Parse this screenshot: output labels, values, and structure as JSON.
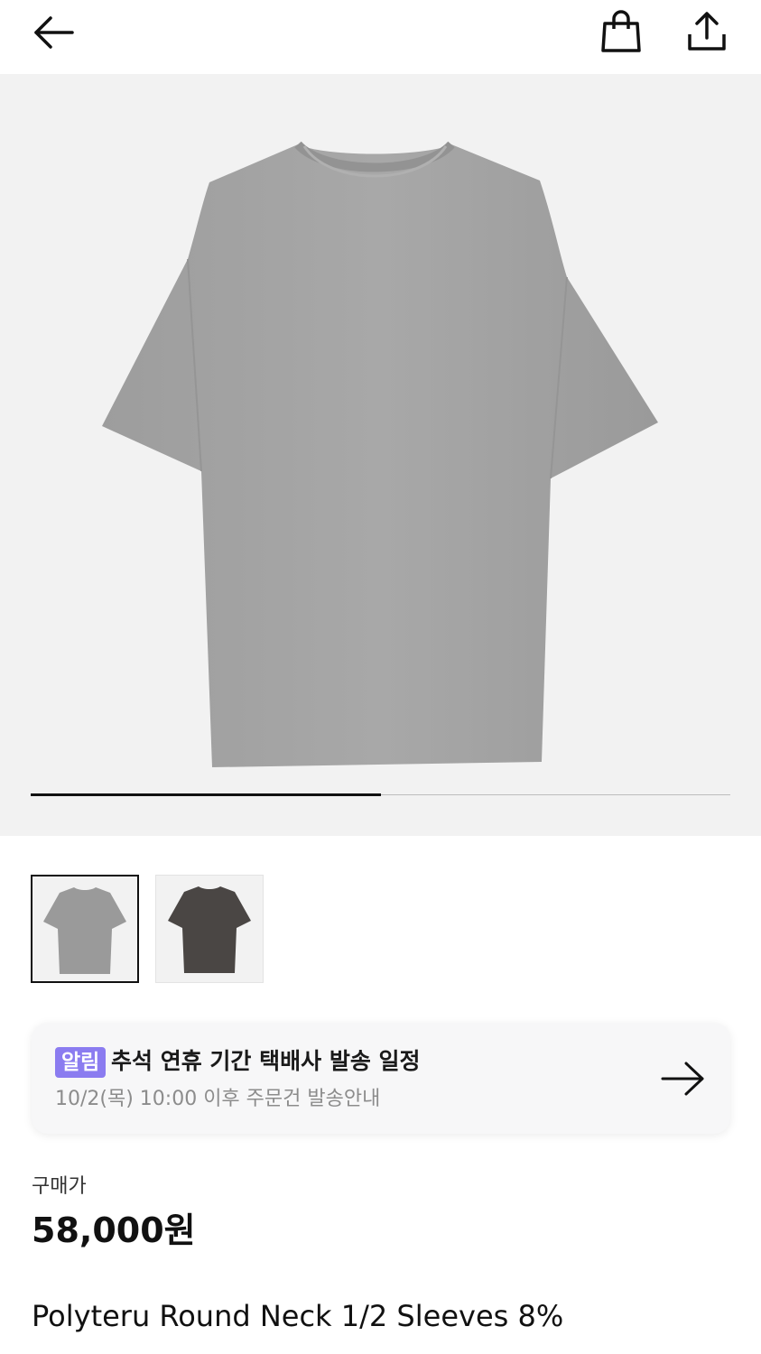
{
  "header": {
    "back_icon": "arrow-left-icon",
    "bag_icon": "shopping-bag-icon",
    "share_icon": "share-icon"
  },
  "gallery": {
    "total_images": 2,
    "current_index": 1,
    "thumbnails": [
      {
        "color": "#9a9a9a",
        "selected": true
      },
      {
        "color": "#4a4644",
        "selected": false
      }
    ]
  },
  "notice": {
    "badge": "알림",
    "title": "추석 연휴 기간 택배사 발송 일정",
    "subtitle": "10/2(목) 10:00 이후 주문건 발송안내",
    "arrow_icon": "arrow-right-icon",
    "badge_color": "#8b7cf0"
  },
  "price": {
    "label": "구매가",
    "value": "58,000원"
  },
  "product": {
    "name": "Polyteru Round Neck 1/2 Sleeves 8%"
  }
}
